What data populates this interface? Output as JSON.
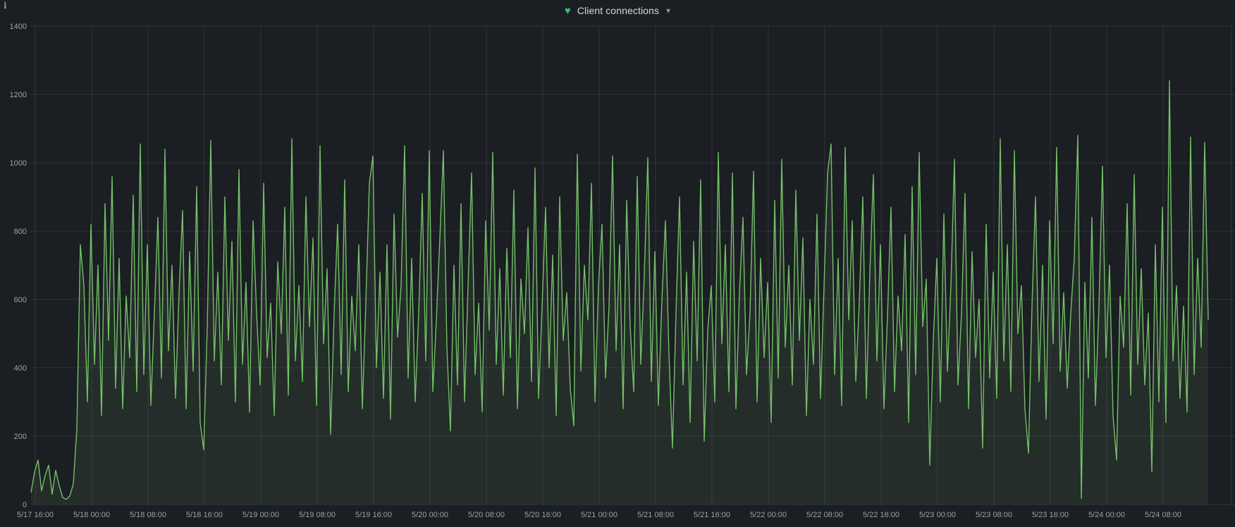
{
  "header": {
    "title": "Client connections",
    "heart_glyph": "♥",
    "caret_glyph": "▾",
    "info_glyph": "i"
  },
  "colors": {
    "background": "#1b1e22",
    "series": "#73bf69",
    "series_fill": "rgba(115,191,105,0.10)",
    "grid": "rgba(204,204,220,0.12)",
    "tick_text": "#9da0a4",
    "title_text": "#d8d9da"
  },
  "chart_data": {
    "type": "line",
    "title": "Client connections",
    "xlabel": "",
    "ylabel": "",
    "ylim": [
      0,
      1400
    ],
    "y_ticks": [
      0,
      200,
      400,
      600,
      800,
      1000,
      1200,
      1400
    ],
    "x_ticks": [
      "5/17 16:00",
      "5/18 00:00",
      "5/18 08:00",
      "5/18 16:00",
      "5/19 00:00",
      "5/19 08:00",
      "5/19 16:00",
      "5/20 00:00",
      "5/20 08:00",
      "5/20 16:00",
      "5/21 00:00",
      "5/21 08:00",
      "5/21 16:00",
      "5/22 00:00",
      "5/22 08:00",
      "5/22 16:00",
      "5/23 00:00",
      "5/23 08:00",
      "5/23 16:00",
      "5/24 00:00",
      "5/24 08:00"
    ],
    "x_tick_interval_hours": 8,
    "grid": true,
    "legend_position": "none",
    "series": [
      {
        "name": "Client connections",
        "color": "#73bf69",
        "sample_interval_minutes": 30,
        "values": [
          35,
          95,
          130,
          40,
          85,
          115,
          30,
          100,
          55,
          20,
          15,
          25,
          60,
          220,
          760,
          640,
          300,
          820,
          410,
          700,
          260,
          880,
          480,
          960,
          340,
          720,
          280,
          610,
          430,
          905,
          330,
          1055,
          380,
          760,
          290,
          560,
          840,
          370,
          1040,
          450,
          700,
          310,
          620,
          860,
          280,
          740,
          390,
          930,
          240,
          160,
          520,
          1065,
          420,
          680,
          350,
          900,
          480,
          770,
          300,
          980,
          410,
          650,
          270,
          830,
          560,
          350,
          940,
          430,
          590,
          260,
          710,
          500,
          870,
          320,
          1070,
          420,
          640,
          360,
          900,
          520,
          780,
          290,
          1050,
          470,
          690,
          205,
          560,
          820,
          380,
          950,
          330,
          610,
          450,
          760,
          280,
          590,
          940,
          1020,
          400,
          680,
          310,
          760,
          250,
          850,
          490,
          640,
          1050,
          370,
          720,
          300,
          560,
          910,
          420,
          1035,
          330,
          540,
          780,
          1035,
          460,
          215,
          700,
          350,
          880,
          300,
          640,
          970,
          380,
          590,
          270,
          830,
          510,
          1030,
          410,
          690,
          320,
          750,
          430,
          920,
          280,
          660,
          500,
          810,
          360,
          985,
          310,
          580,
          870,
          400,
          730,
          260,
          900,
          480,
          620,
          340,
          230,
          1025,
          390,
          700,
          540,
          940,
          300,
          640,
          820,
          370,
          580,
          1020,
          450,
          760,
          280,
          890,
          520,
          330,
          960,
          410,
          670,
          1015,
          360,
          740,
          290,
          600,
          830,
          440,
          165,
          560,
          900,
          350,
          680,
          240,
          770,
          420,
          950,
          185,
          510,
          640,
          300,
          1030,
          470,
          760,
          330,
          970,
          280,
          620,
          840,
          380,
          560,
          975,
          300,
          720,
          430,
          650,
          240,
          890,
          370,
          1010,
          460,
          700,
          350,
          920,
          480,
          780,
          260,
          600,
          410,
          850,
          310,
          640,
          970,
          1055,
          380,
          720,
          290,
          1045,
          540,
          830,
          360,
          590,
          900,
          310,
          680,
          965,
          420,
          760,
          280,
          550,
          870,
          330,
          610,
          450,
          790,
          240,
          930,
          380,
          1030,
          520,
          660,
          115,
          480,
          720,
          300,
          850,
          390,
          640,
          1010,
          350,
          560,
          910,
          280,
          740,
          430,
          600,
          165,
          820,
          370,
          680,
          310,
          1070,
          420,
          760,
          330,
          1035,
          500,
          640,
          280,
          150,
          580,
          900,
          360,
          700,
          250,
          830,
          470,
          1045,
          390,
          620,
          340,
          560,
          720,
          1080,
          18,
          650,
          370,
          840,
          290,
          580,
          990,
          430,
          700,
          260,
          130,
          610,
          460,
          880,
          320,
          965,
          410,
          690,
          350,
          560,
          95,
          760,
          300,
          870,
          240,
          1240,
          420,
          640,
          310,
          580,
          270,
          1075,
          380,
          720,
          460,
          1060,
          540
        ]
      }
    ]
  }
}
